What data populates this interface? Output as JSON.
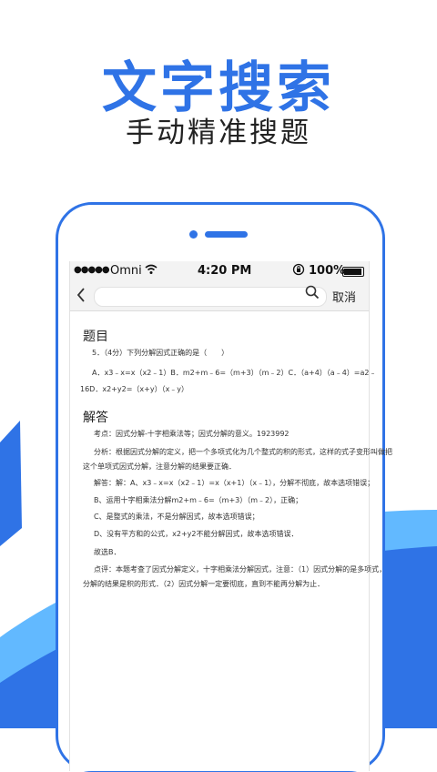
{
  "headline": "文字搜索",
  "subline": "手动精准搜题",
  "colors": {
    "accent": "#2f73e6",
    "wave_light": "#62b9ff"
  },
  "status_bar": {
    "signal": "●●●●●",
    "carrier": "Omni",
    "wifi_icon": "wifi-icon",
    "time": "4:20 PM",
    "lock_icon": "rotation-lock-icon",
    "battery_percent": "100%"
  },
  "nav_bar": {
    "back_icon": "chevron-left-icon",
    "search_placeholder": "",
    "search_icon": "search-icon",
    "cancel_label": "取消"
  },
  "question": {
    "heading": "题目",
    "stem": "5．（4分）下列分解因式正确的是（　　）",
    "options_line1": "A．x3﹣x=x（x2﹣1）B．m2+m﹣6=（m+3）（m﹣2）C．（a+4）（a﹣4）=a2﹣",
    "options_line2": "16D．x2+y2=（x+y）（x﹣y）"
  },
  "answer": {
    "heading": "解答",
    "lines": [
      "考点：因式分解-十字相乘法等；因式分解的意义。1923992",
      "分析：根据因式分解的定义，把一个多项式化为几个整式的积的形式，这样的式子变形叫做把",
      "这个单项式因式分解，注意分解的结果要正确．",
      "解答：解：A、x3﹣x=x（x2﹣1）=x（x+1）（x﹣1），分解不彻底，故本选项错误；",
      "B、运用十字相乘法分解m2+m﹣6=（m+3）（m﹣2），正确；",
      "C、是整式的乘法，不是分解因式，故本选项错误；",
      "D、没有平方和的公式，x2+y2不能分解因式，故本选项错误．",
      "故选B．",
      "点评：本题考查了因式分解定义，十字相乘法分解因式，注意：（1）因式分解的是多项式，",
      "分解的结果是积的形式．（2）因式分解一定要彻底，直到不能再分解为止．"
    ]
  }
}
